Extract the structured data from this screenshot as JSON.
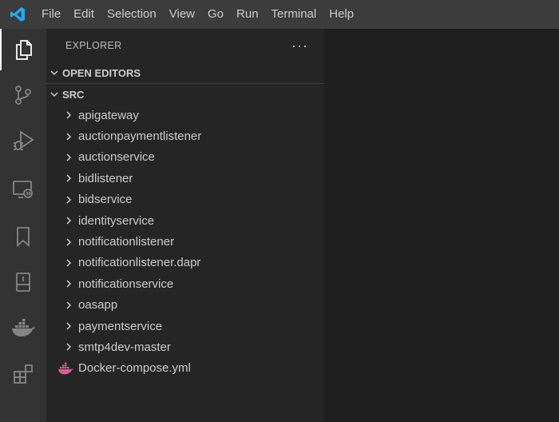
{
  "menu": [
    "File",
    "Edit",
    "Selection",
    "View",
    "Go",
    "Run",
    "Terminal",
    "Help"
  ],
  "activity_bar": [
    {
      "icon": "files-icon",
      "active": true
    },
    {
      "icon": "source-control-icon"
    },
    {
      "icon": "run-debug-icon"
    },
    {
      "icon": "remote-explorer-icon"
    },
    {
      "icon": "bookmarks-icon"
    },
    {
      "icon": "book-icon"
    },
    {
      "icon": "docker-icon"
    },
    {
      "icon": "extensions-icon"
    }
  ],
  "sidebar": {
    "title": "EXPLORER",
    "more": "···",
    "open_editors": "OPEN EDITORS",
    "root": "SRC",
    "items": [
      {
        "label": "apigateway",
        "type": "folder"
      },
      {
        "label": "auctionpaymentlistener",
        "type": "folder"
      },
      {
        "label": "auctionservice",
        "type": "folder"
      },
      {
        "label": "bidlistener",
        "type": "folder"
      },
      {
        "label": "bidservice",
        "type": "folder"
      },
      {
        "label": "identityservice",
        "type": "folder"
      },
      {
        "label": "notificationlistener",
        "type": "folder"
      },
      {
        "label": "notificationlistener.dapr",
        "type": "folder"
      },
      {
        "label": "notificationservice",
        "type": "folder"
      },
      {
        "label": "oasapp",
        "type": "folder"
      },
      {
        "label": "paymentservice",
        "type": "folder"
      },
      {
        "label": "smtp4dev-master",
        "type": "folder"
      },
      {
        "label": "Docker-compose.yml",
        "type": "docker-file"
      }
    ]
  },
  "colors": {
    "titlebar": "#3c3c3c",
    "activitybar": "#333333",
    "sidebar": "#252526",
    "editor": "#1e1e1e",
    "vscode_blue": "#23a9f2",
    "docker_file_icon": "#e05a9a"
  }
}
